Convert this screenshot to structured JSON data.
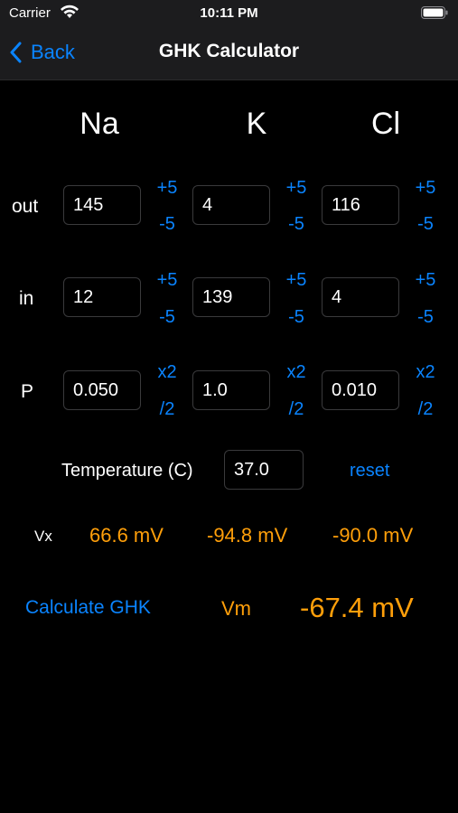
{
  "status": {
    "carrier": "Carrier",
    "time": "10:11 PM"
  },
  "nav": {
    "back": "Back",
    "title": "GHK Calculator"
  },
  "ions": [
    "Na",
    "K",
    "Cl"
  ],
  "rows": {
    "out": {
      "label": "out",
      "values": [
        "145",
        "4",
        "116"
      ],
      "step_up": "+5",
      "step_down": "-5"
    },
    "in": {
      "label": "in",
      "values": [
        "12",
        "139",
        "4"
      ],
      "step_up": "+5",
      "step_down": "-5"
    },
    "p": {
      "label": "P",
      "values": [
        "0.050",
        "1.0",
        "0.010"
      ],
      "step_up": "x2",
      "step_down": "/2"
    }
  },
  "temperature": {
    "label": "Temperature (C)",
    "value": "37.0",
    "reset": "reset"
  },
  "vx": {
    "label": "Vx",
    "values": [
      "66.6 mV",
      "-94.8 mV",
      "-90.0 mV"
    ]
  },
  "result": {
    "calculate": "Calculate GHK",
    "vm_label": "Vm",
    "vm_value": "-67.4 mV"
  },
  "colors": {
    "accent": "#0a84ff",
    "result": "#ff9f0a",
    "background": "#000000",
    "bar": "#1c1c1e"
  }
}
